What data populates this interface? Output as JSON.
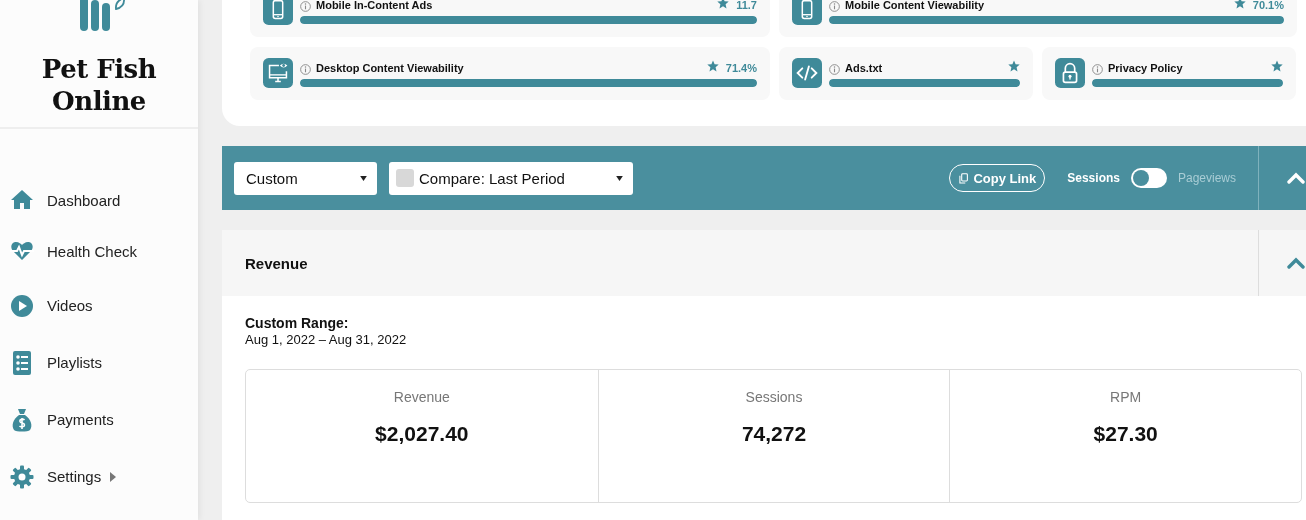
{
  "sidebar": {
    "brand": "Pet Fish Online",
    "nav": [
      {
        "label": "Dashboard",
        "kind": "home",
        "has_submenu": false
      },
      {
        "label": "Health Check",
        "kind": "heartbeat",
        "has_submenu": false
      },
      {
        "label": "Videos",
        "kind": "play",
        "has_submenu": false
      },
      {
        "label": "Playlists",
        "kind": "list",
        "has_submenu": false
      },
      {
        "label": "Payments",
        "kind": "moneybag",
        "has_submenu": false
      },
      {
        "label": "Settings",
        "kind": "gear",
        "has_submenu": true
      }
    ]
  },
  "health_checks": [
    [
      {
        "name": "Mobile In-Content Ads",
        "kind": "phone",
        "value": "11.7",
        "level": 1,
        "starred": true
      },
      {
        "name": "Mobile Content Viewability",
        "kind": "phone",
        "value": "70.1%",
        "level": 1,
        "starred": true
      }
    ],
    [
      {
        "name": "Desktop Content Viewability",
        "kind": "desktop",
        "value": "71.4%",
        "level": 1,
        "starred": true
      },
      {
        "name": "Ads.txt",
        "kind": "code",
        "level": 1,
        "starred": true
      },
      {
        "name": "Privacy Policy",
        "kind": "lock",
        "level": 1,
        "starred": true
      }
    ]
  ],
  "toolbar": {
    "range_select": {
      "value": "Custom"
    },
    "compare_select": {
      "value": "Compare: Last Period",
      "checked": false
    },
    "copy_link": "Copy Link",
    "toggle": {
      "left": "Sessions",
      "right": "Pageviews",
      "on": false
    },
    "expanded": true
  },
  "revenue": {
    "title": "Revenue",
    "expanded": true,
    "range_label": "Custom Range:",
    "range": "Aug 1, 2022 – Aug 31, 2022",
    "stats": [
      {
        "label": "Revenue",
        "value": "$2,027.40"
      },
      {
        "label": "Sessions",
        "value": "74,272"
      },
      {
        "label": "RPM",
        "value": "$27.30"
      }
    ]
  }
}
